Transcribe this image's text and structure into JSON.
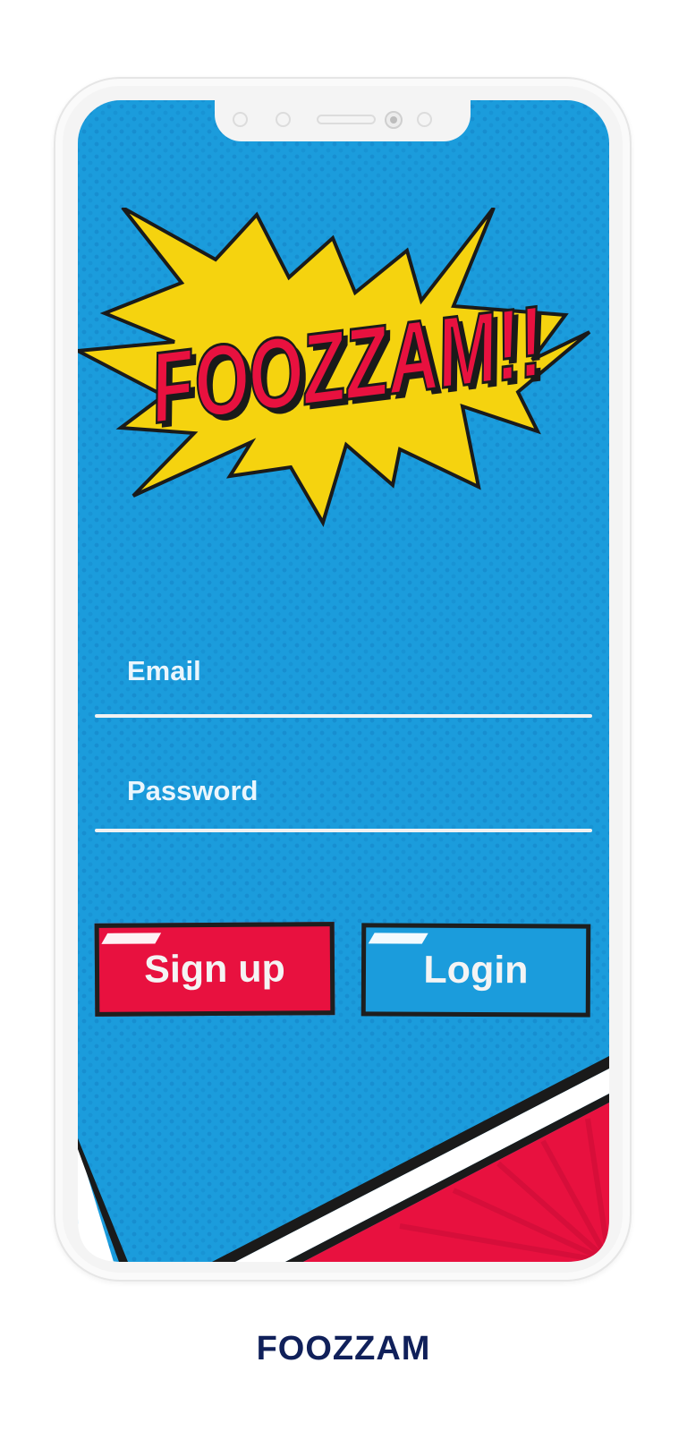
{
  "app": {
    "logo_text": "FOOZZAM!!",
    "caption": "FOOZZAM"
  },
  "login_form": {
    "email_placeholder": "Email",
    "password_placeholder": "Password",
    "signup_label": "Sign up",
    "login_label": "Login"
  },
  "colors": {
    "background_blue": "#1b9cdc",
    "accent_red": "#e8113f",
    "burst_yellow": "#f5d30f",
    "caption_navy": "#10205a"
  }
}
